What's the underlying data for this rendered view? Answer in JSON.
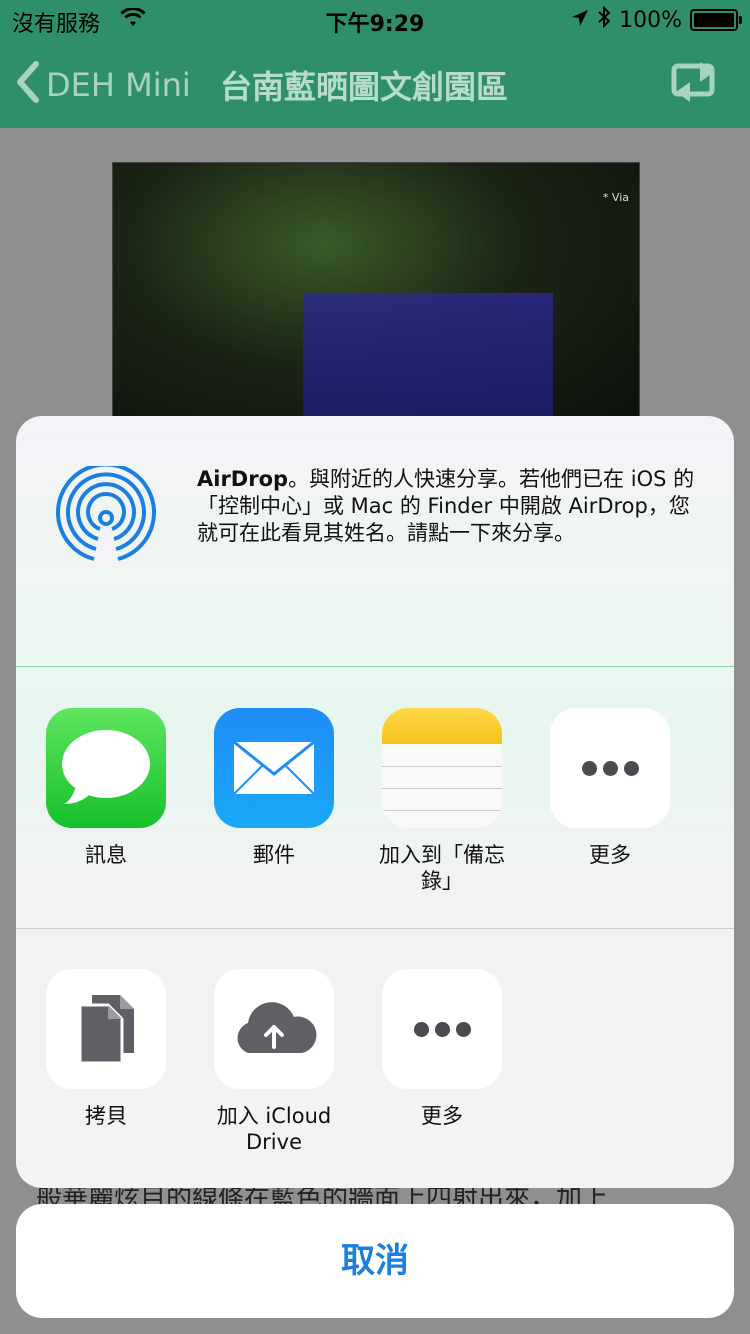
{
  "status_bar": {
    "carrier": "沒有服務",
    "time": "下午9:29",
    "battery": "100%"
  },
  "nav": {
    "back_label": "DEH Mini",
    "title": "台南藍晒圖文創園區"
  },
  "content": {
    "photo_watermark": "* Via",
    "body_text": "般華麗炫目的線條在藍色的牆面上四射出來，加上"
  },
  "share_sheet": {
    "airdrop": {
      "title": "AirDrop",
      "description": "。與附近的人快速分享。若他們已在 iOS 的「控制中心」或 Mac 的 Finder 中開啟 AirDrop，您就可在此看見其姓名。請點一下來分享。"
    },
    "apps": [
      {
        "label": "訊息",
        "icon": "messages-icon"
      },
      {
        "label": "郵件",
        "icon": "mail-icon"
      },
      {
        "label": "加入到「備忘錄」",
        "icon": "notes-icon"
      },
      {
        "label": "更多",
        "icon": "more-icon"
      }
    ],
    "actions": [
      {
        "label": "拷貝",
        "icon": "copy-icon"
      },
      {
        "label": "加入 iCloud Drive",
        "icon": "icloud-upload-icon"
      },
      {
        "label": "更多",
        "icon": "more-icon"
      }
    ]
  },
  "cancel_label": "取消",
  "colors": {
    "nav_green": "#2f8f69",
    "ios_blue": "#1a7fe0"
  }
}
